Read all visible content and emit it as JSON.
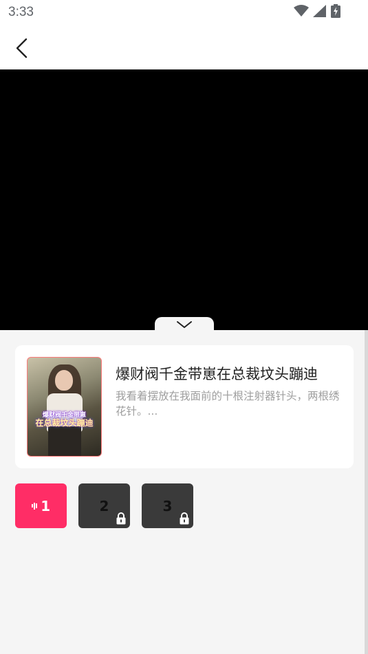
{
  "status_bar": {
    "time": "3:33",
    "icons": [
      "wifi-icon",
      "cellular-signal-icon",
      "battery-charging-icon"
    ]
  },
  "nav": {
    "back_icon": "chevron-left-icon"
  },
  "player": {
    "collapse_icon": "chevron-down-icon"
  },
  "drama": {
    "cover_text_line1": "爆财阀千金带崽",
    "cover_text_line2": "在总裁坟头蹦迪",
    "title": "爆财阀千金带崽在总裁坟头蹦迪",
    "description": "我看着摆放在我面前的十根注射器针头，两根绣花针。..."
  },
  "episodes": [
    {
      "label": "1",
      "state": "playing"
    },
    {
      "label": "2",
      "state": "locked"
    },
    {
      "label": "3",
      "state": "locked"
    }
  ],
  "colors": {
    "accent": "#ff2d66",
    "locked_bg": "#3a3a3a",
    "panel_bg": "#f5f5f5"
  }
}
